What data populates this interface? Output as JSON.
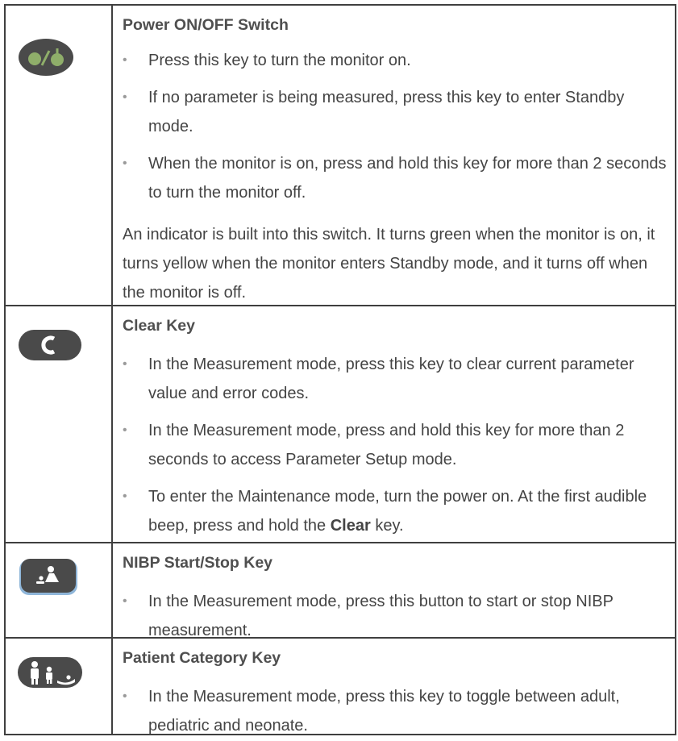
{
  "rows": [
    {
      "title": "Power ON/OFF Switch",
      "icon": "power-on-off-icon",
      "bullets": [
        "Press this key to turn the monitor on.",
        "If no parameter is being measured, press this key to enter Standby mode.",
        "When the monitor is on, press and hold this key for more than 2 seconds to turn the monitor off."
      ],
      "paragraph": "An indicator is built into this switch. It turns green when the monitor is on, it turns yellow when the monitor enters Standby mode, and it turns off when the monitor is off."
    },
    {
      "title": "Clear Key",
      "icon": "clear-c-icon",
      "bullets": [
        "In the Measurement mode, press this key to clear current parameter value and error codes.",
        "In the Measurement mode, press and hold this key for more than 2 seconds to access Parameter Setup mode.",
        {
          "before": "To enter the Maintenance mode, turn the power on. At the first audible beep, press and hold the ",
          "bold": "Clear",
          "after": " key."
        }
      ]
    },
    {
      "title": "NIBP Start/Stop Key",
      "icon": "nibp-cuff-icon",
      "bullets": [
        "In the Measurement mode, press this button to start or stop NIBP measurement."
      ]
    },
    {
      "title": "Patient Category Key",
      "icon": "patient-category-icon",
      "bullets": [
        "In the Measurement mode, press this key to toggle between adult, pediatric and neonate."
      ]
    }
  ],
  "colors": {
    "border": "#3f3f3f",
    "text": "#444444",
    "key_body": "#4a4a4a",
    "power_led": "#8fae6a",
    "nibp_rim": "#8fb6d9"
  }
}
